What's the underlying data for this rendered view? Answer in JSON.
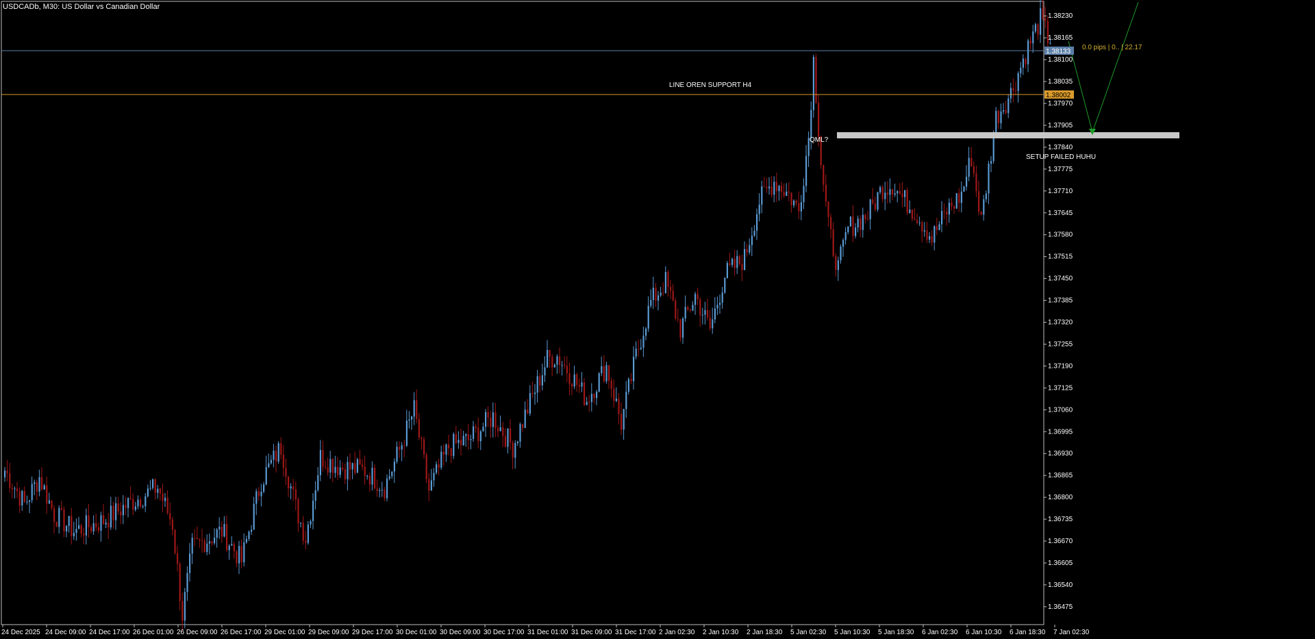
{
  "window": {
    "title": "USDCADb, M30:  US Dollar vs Canadian Dollar"
  },
  "colors": {
    "background": "#000000",
    "bull": "#5b9bd5",
    "bear": "#a01818",
    "axis": "#c0c0c0",
    "price_line": "#5b7fa8",
    "support_line": "#d99a2b",
    "zone": "#c8c8c8",
    "projection": "#1f9a2a",
    "measure_text": "#d4b030"
  },
  "chart_data": {
    "type": "candlestick",
    "symbol": "USDCADb",
    "timeframe": "M30",
    "y_ticks": [
      "1.38230",
      "1.38165",
      "1.38100",
      "1.38035",
      "1.37970",
      "1.37905",
      "1.37840",
      "1.37775",
      "1.37710",
      "1.37645",
      "1.37580",
      "1.37515",
      "1.37450",
      "1.37385",
      "1.37320",
      "1.37255",
      "1.37190",
      "1.37125",
      "1.37060",
      "1.36995",
      "1.36930",
      "1.36865",
      "1.36800",
      "1.36735",
      "1.36670",
      "1.36605",
      "1.36540",
      "1.36475"
    ],
    "ylim": [
      1.3643,
      1.38265
    ],
    "x_ticks": [
      "24 Dec 2025",
      "24 Dec 09:00",
      "24 Dec 17:00",
      "26 Dec 01:00",
      "26 Dec 09:00",
      "26 Dec 17:00",
      "29 Dec 01:00",
      "29 Dec 09:00",
      "29 Dec 17:00",
      "30 Dec 01:00",
      "30 Dec 09:00",
      "30 Dec 17:00",
      "31 Dec 01:00",
      "31 Dec 09:00",
      "31 Dec 17:00",
      "2 Jan 02:30",
      "2 Jan 10:30",
      "2 Jan 18:30",
      "5 Jan 02:30",
      "5 Jan 10:30",
      "5 Jan 18:30",
      "6 Jan 02:30",
      "6 Jan 10:30",
      "6 Jan 18:30",
      "7 Jan 02:30"
    ],
    "current_price": "1.38133",
    "support_price": "1.38002",
    "anchors": [
      [
        0,
        1.3688
      ],
      [
        8,
        1.3678
      ],
      [
        14,
        1.3686
      ],
      [
        20,
        1.3675
      ],
      [
        28,
        1.367
      ],
      [
        40,
        1.3673
      ],
      [
        50,
        1.3678
      ],
      [
        62,
        1.3683
      ],
      [
        68,
        1.3672
      ],
      [
        72,
        1.3645
      ],
      [
        76,
        1.3665
      ],
      [
        88,
        1.367
      ],
      [
        96,
        1.3661
      ],
      [
        104,
        1.3685
      ],
      [
        112,
        1.3695
      ],
      [
        118,
        1.3677
      ],
      [
        122,
        1.3668
      ],
      [
        128,
        1.3692
      ],
      [
        136,
        1.3689
      ],
      [
        146,
        1.3688
      ],
      [
        154,
        1.3683
      ],
      [
        160,
        1.3694
      ],
      [
        166,
        1.3706
      ],
      [
        172,
        1.3682
      ],
      [
        180,
        1.3695
      ],
      [
        188,
        1.3697
      ],
      [
        198,
        1.3704
      ],
      [
        206,
        1.3695
      ],
      [
        214,
        1.371
      ],
      [
        220,
        1.3721
      ],
      [
        224,
        1.3722
      ],
      [
        230,
        1.3716
      ],
      [
        236,
        1.3709
      ],
      [
        244,
        1.3719
      ],
      [
        250,
        1.3702
      ],
      [
        256,
        1.3722
      ],
      [
        262,
        1.3738
      ],
      [
        268,
        1.3744
      ],
      [
        274,
        1.373
      ],
      [
        280,
        1.374
      ],
      [
        286,
        1.373
      ],
      [
        292,
        1.3746
      ],
      [
        300,
        1.3751
      ],
      [
        306,
        1.3768
      ],
      [
        312,
        1.3774
      ],
      [
        318,
        1.377
      ],
      [
        322,
        1.3765
      ],
      [
        326,
        1.3787
      ],
      [
        328,
        1.381
      ],
      [
        331,
        1.378
      ],
      [
        334,
        1.376
      ],
      [
        338,
        1.3748
      ],
      [
        342,
        1.376
      ],
      [
        350,
        1.3764
      ],
      [
        356,
        1.3772
      ],
      [
        360,
        1.3773
      ],
      [
        364,
        1.3769
      ],
      [
        370,
        1.3764
      ],
      [
        376,
        1.3757
      ],
      [
        382,
        1.3765
      ],
      [
        388,
        1.377
      ],
      [
        392,
        1.3781
      ],
      [
        396,
        1.3762
      ],
      [
        402,
        1.3793
      ],
      [
        408,
        1.38
      ],
      [
        414,
        1.3812
      ],
      [
        420,
        1.3822
      ],
      [
        424,
        1.3815
      ]
    ],
    "annotations": {
      "support_label": "LINE OREN SUPPORT H4",
      "zone_label": "QML?",
      "setup_label": "SETUP FAILED HUHU",
      "measure_label": "0.0 pips | 0.. | 22.17"
    }
  }
}
